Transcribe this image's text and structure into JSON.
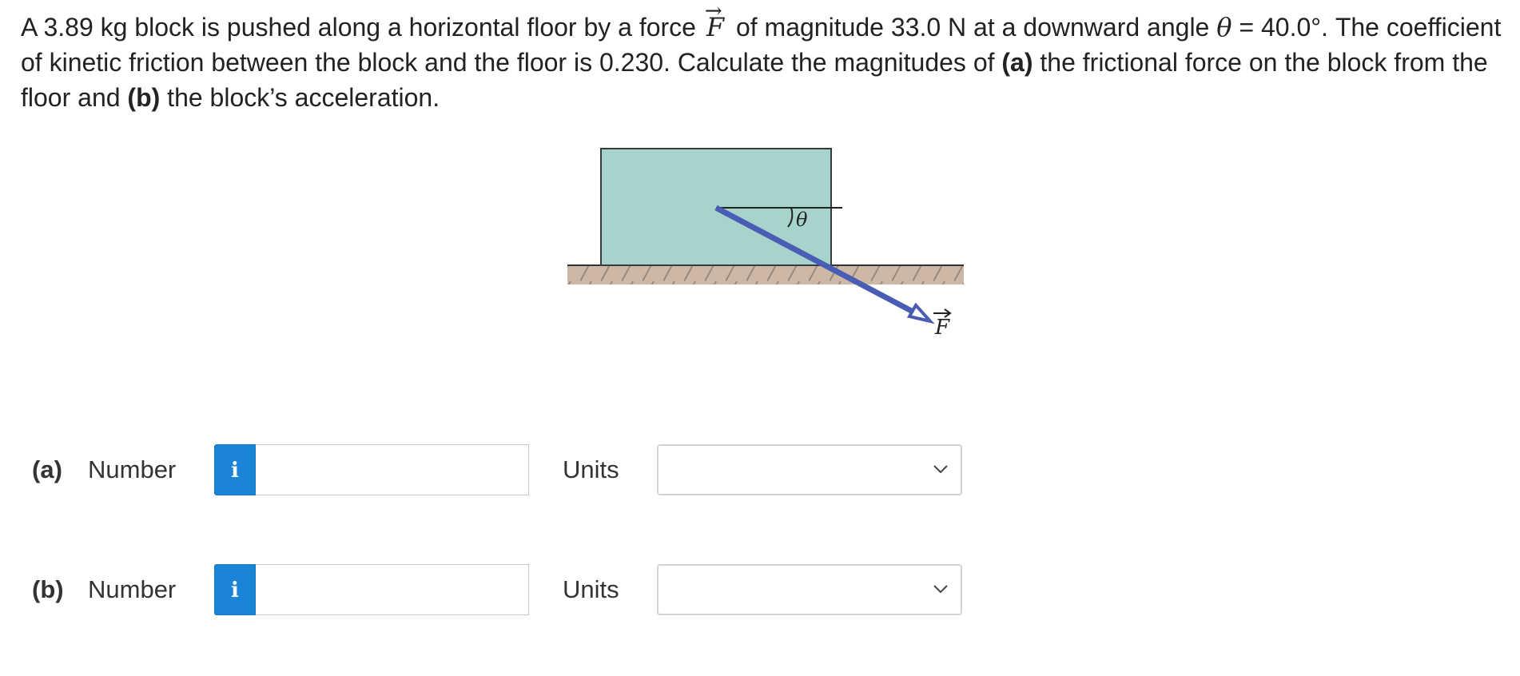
{
  "problem": {
    "t1": "A 3.89 kg block is pushed along a horizontal floor by a force",
    "force_symbol": "F",
    "t2": "of magnitude 33.0 N at a downward angle",
    "theta_symbol": "θ",
    "t3": "= 40.0°. The coefficient of kinetic friction between the block and the floor is 0.230. Calculate the magnitudes of",
    "part_a_marker": "(a)",
    "t4": "the frictional force on the block from the floor and",
    "part_b_marker": "(b)",
    "t5": "the block’s acceleration."
  },
  "figure": {
    "theta_label": "θ",
    "force_label": "F",
    "colors": {
      "block": "#a7d3cd",
      "block_outline": "#3a3a3a",
      "floor": "#cdb7a7",
      "force_vector": "#4a5db4"
    }
  },
  "answers": [
    {
      "part_label": "(a)",
      "number_label": "Number",
      "info_icon": "i",
      "number_value": "",
      "units_label": "Units",
      "units_value": ""
    },
    {
      "part_label": "(b)",
      "number_label": "Number",
      "info_icon": "i",
      "number_value": "",
      "units_label": "Units",
      "units_value": ""
    }
  ],
  "colors": {
    "info_button": "#1a85d6",
    "text": "#222222"
  }
}
